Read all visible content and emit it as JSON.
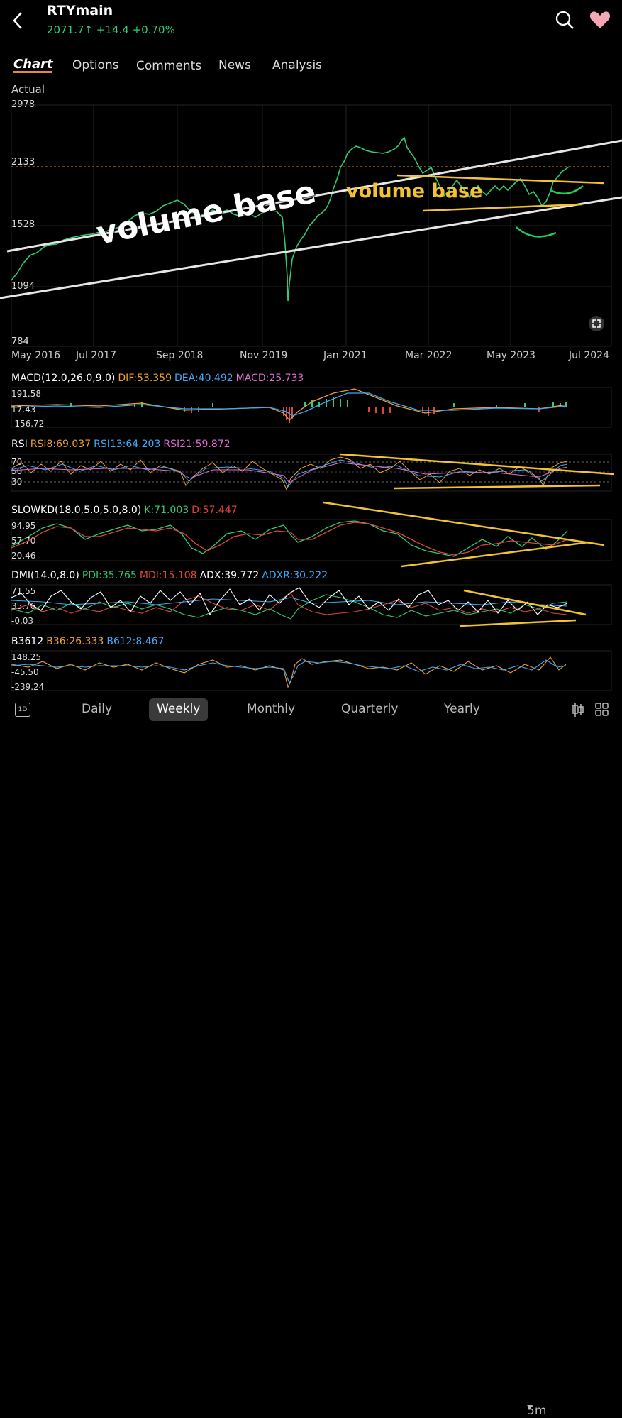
{
  "header": {
    "back_icon": "chevron-left-icon",
    "symbol": "RTYmain",
    "price": "2071.7",
    "change": "+14.4",
    "change_pct": "+0.70%",
    "search_icon": "search-icon",
    "favorite_icon": "heart-icon"
  },
  "tabs": [
    "Chart",
    "Options",
    "Comments",
    "News",
    "Analysis"
  ],
  "chart": {
    "mode_label": "Actual",
    "y_ticks": [
      "2978",
      "2133",
      "1528",
      "1094",
      "784"
    ],
    "x_ticks": [
      "May 2016",
      "Jul 2017",
      "Sep 2018",
      "Nov 2019",
      "Jan 2021",
      "Mar 2022",
      "May 2023",
      "Jul 2024"
    ],
    "annotation_large": "volume base",
    "annotation_small": "volume base"
  },
  "macd": {
    "name": "MACD(12.0,26.0,9.0)",
    "dif": "DIF:53.359",
    "dea": "DEA:40.492",
    "macd": "MACD:25.733",
    "ticks": [
      "191.58",
      "17.43",
      "-156.72"
    ]
  },
  "rsi": {
    "name": "RSI",
    "rsi8": "RSI8:69.037",
    "rsi13": "RSI13:64.203",
    "rsi21": "RSI21:59.872",
    "ticks": [
      "70",
      "50",
      "30"
    ]
  },
  "slowkd": {
    "name": "SLOWKD(18.0,5.0,5.0,8.0)",
    "k": "K:71.003",
    "d": "D:57.447",
    "ticks": [
      "94.95",
      "57.70",
      "20.46"
    ]
  },
  "dmi": {
    "name": "DMI(14.0,8.0)",
    "pdi": "PDI:35.765",
    "mdi": "MDI:15.108",
    "adx": "ADX:39.772",
    "adxr": "ADXR:30.222",
    "ticks": [
      "71.55",
      "35.76",
      "-0.03"
    ]
  },
  "b3612": {
    "name": "B3612",
    "b36": "B36:26.333",
    "b612": "B612:8.467",
    "ticks": [
      "148.25",
      "-45.50",
      "-239.24"
    ]
  },
  "bottom_bar": {
    "period_icon": "1D",
    "periods": [
      "Daily",
      "Weekly",
      "Monthly",
      "Quarterly",
      "Yearly"
    ],
    "interval": "5m",
    "candle_icon": "candlestick-icon",
    "grid_icon": "grid-icon"
  },
  "colors": {
    "up": "#2ecc71",
    "accent": "#e8893a",
    "annotation_yellow": "#f2c230",
    "dif": "#f0a030",
    "dea": "#3fa9f5",
    "macd": "#e070d0",
    "mdi": "#e0443c"
  }
}
